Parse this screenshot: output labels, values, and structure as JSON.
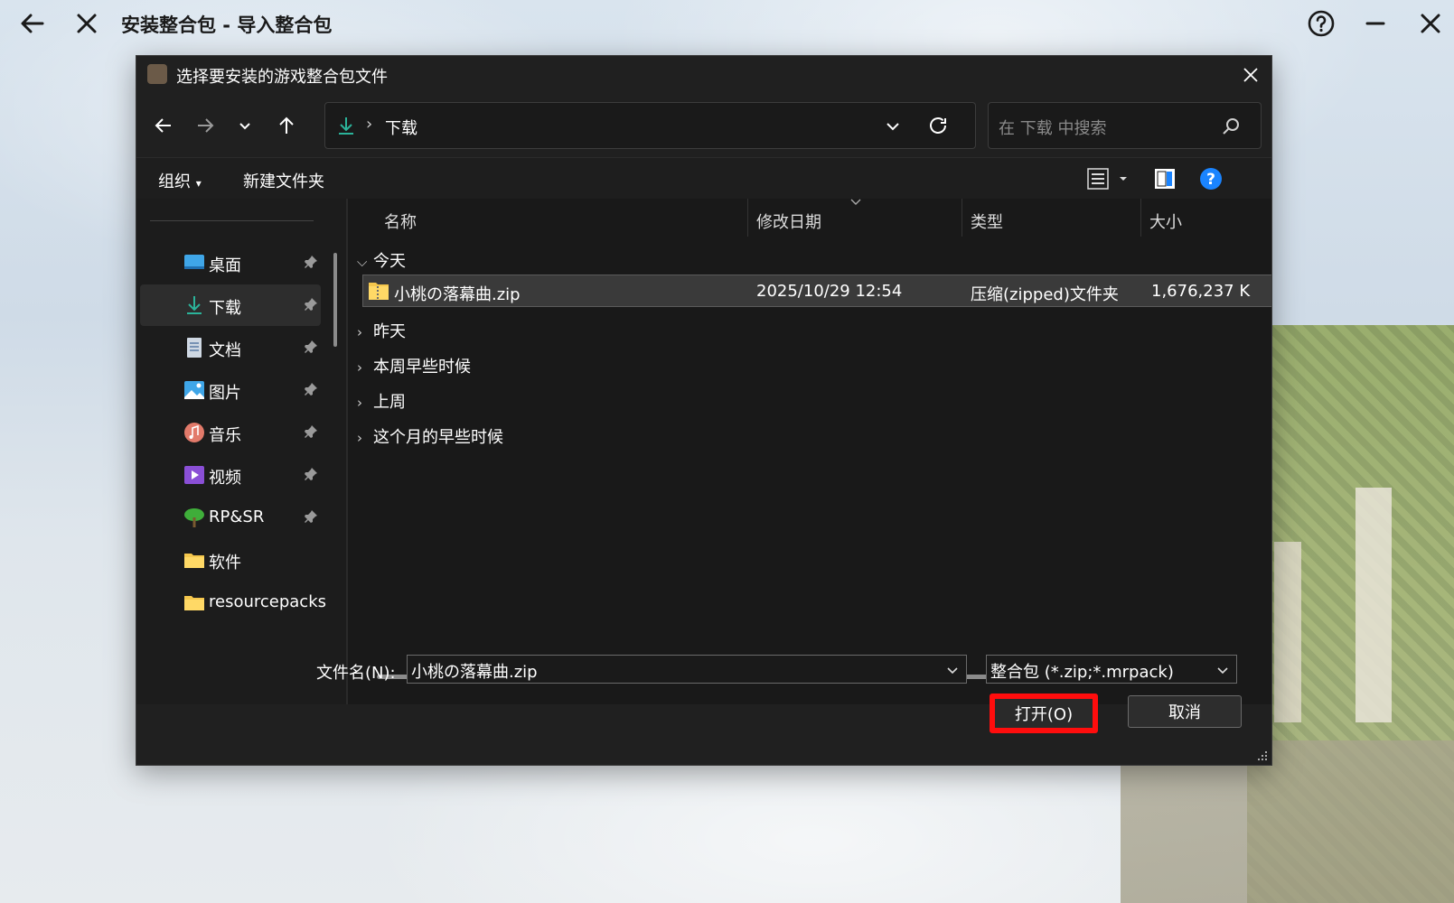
{
  "app": {
    "title": "安装整合包 - 导入整合包"
  },
  "dialog": {
    "title": "选择要安装的游戏整合包文件",
    "address": {
      "crumb": "下载"
    },
    "search": {
      "placeholder": "在 下载 中搜索"
    },
    "commands": {
      "organize": "组织",
      "new_folder": "新建文件夹"
    },
    "sidebar": [
      {
        "label": "桌面",
        "icon": "desktop-icon",
        "pinned": true
      },
      {
        "label": "下载",
        "icon": "download-icon",
        "pinned": true,
        "selected": true
      },
      {
        "label": "文档",
        "icon": "document-icon",
        "pinned": true
      },
      {
        "label": "图片",
        "icon": "pictures-icon",
        "pinned": true
      },
      {
        "label": "音乐",
        "icon": "music-icon",
        "pinned": true
      },
      {
        "label": "视频",
        "icon": "video-icon",
        "pinned": true
      },
      {
        "label": "RP&SR",
        "icon": "tree-icon",
        "pinned": true
      },
      {
        "label": "软件",
        "icon": "folder-icon",
        "pinned": false
      },
      {
        "label": "resourcepacks",
        "icon": "folder-icon",
        "pinned": false
      }
    ],
    "columns": {
      "name": "名称",
      "date": "修改日期",
      "type": "类型",
      "size": "大小"
    },
    "groups": {
      "today": "今天",
      "yesterday": "昨天",
      "this_week": "本周早些时候",
      "last_week": "上周",
      "this_month": "这个月的早些时候"
    },
    "file": {
      "name": "小桃の落幕曲.zip",
      "date": "2025/10/29 12:54",
      "type": "压缩(zipped)文件夹",
      "size": "1,676,237 K"
    },
    "footer": {
      "filename_label": "文件名(N):",
      "filename_value": "小桃の落幕曲.zip",
      "filter": "整合包 (*.zip;*.mrpack)",
      "open": "打开(O)",
      "cancel": "取消"
    }
  },
  "colors": {
    "accent": "#1a84ff",
    "highlight": "#ff0d0d",
    "dialog_bg": "#191919"
  }
}
